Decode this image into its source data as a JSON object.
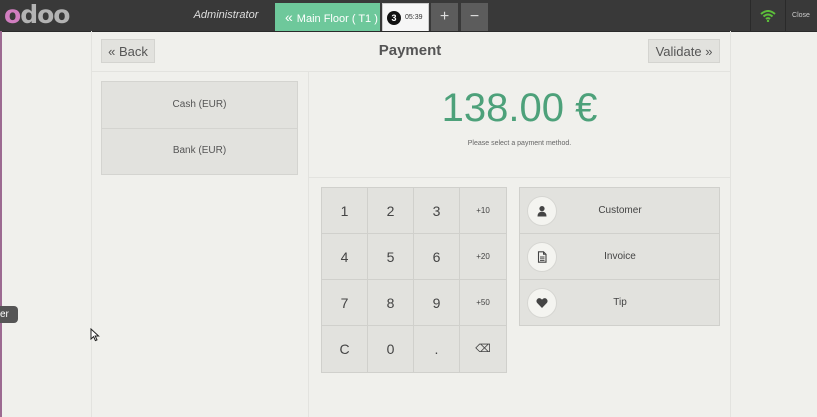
{
  "topbar": {
    "logo": "odoo",
    "username": "Administrator",
    "floor_tab": {
      "prefix": "«",
      "label": "Main Floor ( T1 )"
    },
    "order": {
      "number": "3",
      "time": "05:39"
    },
    "add_label": "+",
    "remove_label": "−",
    "close_label": "Close",
    "wifi_icon": "wifi-icon",
    "wifi_color": "#5cbf3a"
  },
  "left_pill": "er",
  "header": {
    "back_label": "« Back",
    "title": "Payment",
    "validate_label": "Validate »"
  },
  "payment_methods": [
    {
      "label": "Cash (EUR)"
    },
    {
      "label": "Bank (EUR)"
    }
  ],
  "summary": {
    "total": "138.00 €",
    "hint": "Please select a payment method.",
    "total_color": "#4da17a"
  },
  "numpad": {
    "keys": [
      "1",
      "2",
      "3",
      "+10",
      "4",
      "5",
      "6",
      "+20",
      "7",
      "8",
      "9",
      "+50",
      "C",
      "0",
      ".",
      "⌫"
    ]
  },
  "actions": [
    {
      "label": "Customer",
      "icon": "user-icon"
    },
    {
      "label": "Invoice",
      "icon": "document-icon"
    },
    {
      "label": "Tip",
      "icon": "heart-icon"
    }
  ]
}
